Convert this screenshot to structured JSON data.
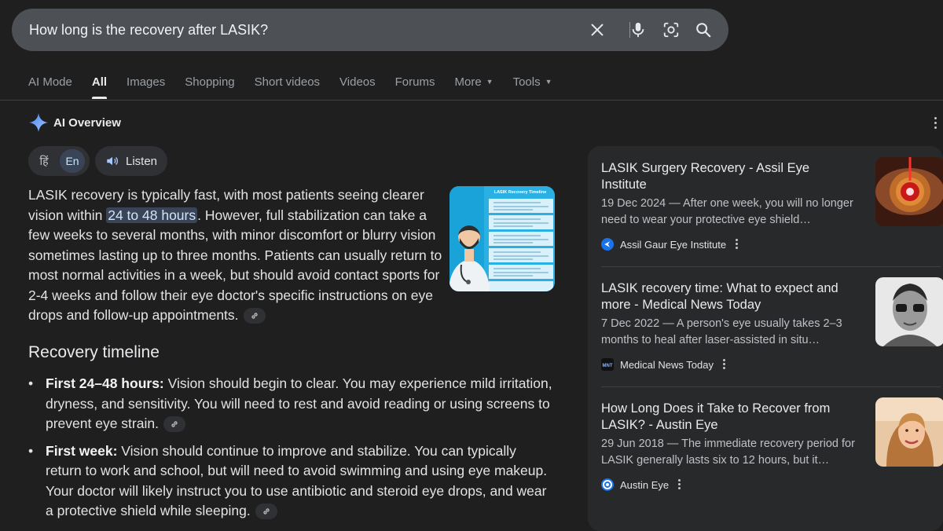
{
  "search": {
    "query": "How long is the recovery after LASIK?"
  },
  "tabs": [
    {
      "label": "AI Mode"
    },
    {
      "label": "All"
    },
    {
      "label": "Images"
    },
    {
      "label": "Shopping"
    },
    {
      "label": "Short videos"
    },
    {
      "label": "Videos"
    },
    {
      "label": "Forums"
    },
    {
      "label": "More"
    },
    {
      "label": "Tools"
    }
  ],
  "ai_overview": {
    "title": "AI Overview",
    "lang_hi": "हिं",
    "lang_en": "En",
    "listen_label": "Listen",
    "para_1": "LASIK recovery is typically fast, with most patients seeing clearer vision within ",
    "para_highlight": "24 to 48 hours",
    "para_2": ". However, full stabilization can take a few weeks to several months, with minor discomfort or blurry vision sometimes lasting up to three months. Patients can usually return to most normal activities in a week, but should avoid contact sports for 2-4 weeks and follow their eye doctor's specific instructions on eye drops and follow-up appointments.",
    "image_title": "LASIK Recovery Timeline",
    "section_heading": "Recovery timeline",
    "bullets": [
      {
        "bold": "First 24–48 hours:",
        "text": " Vision should begin to clear. You may experience mild irritation, dryness, and sensitivity. You will need to rest and avoid reading or using screens to prevent eye strain."
      },
      {
        "bold": "First week:",
        "text": " Vision should continue to improve and stabilize. You can typically return to work and school, but will need to avoid swimming and using eye makeup. Your doctor will likely instruct you to use antibiotic and steroid eye drops, and wear a protective shield while sleeping."
      }
    ]
  },
  "sources": [
    {
      "title": "LASIK Surgery Recovery - Assil Eye Institute",
      "date": "19 Dec 2024",
      "snippet": " — After one week, you will no longer need to wear your protective eye shield…",
      "site": "Assil Gaur Eye Institute"
    },
    {
      "title": "LASIK recovery time: What to expect and more - Medical News Today",
      "date": "7 Dec 2022",
      "snippet": " — A person's eye usually takes 2–3 months to heal after laser-assisted in situ…",
      "site": "Medical News Today"
    },
    {
      "title": "How Long Does it Take to Recover from LASIK? - Austin Eye",
      "date": "29 Jun 2018",
      "snippet": " — The immediate recovery period for LASIK generally lasts six to 12 hours, but it…",
      "site": "Austin Eye"
    }
  ],
  "colors": {
    "background": "#1f1f1f",
    "search_bar": "#4d5156",
    "highlight": "#394457",
    "source_panel": "#28292a"
  }
}
